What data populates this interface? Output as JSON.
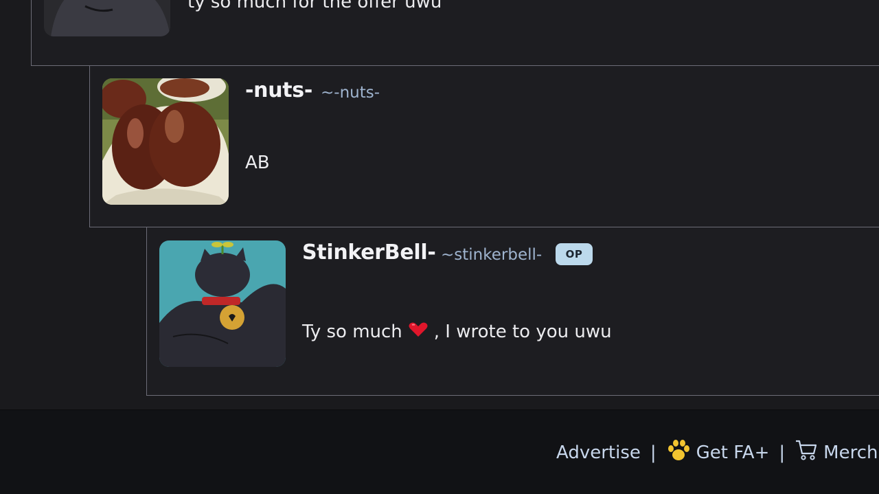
{
  "comments": [
    {
      "message": "ty so much for the offer uwu"
    },
    {
      "display_name": "-nuts-",
      "username": "~-nuts-",
      "message": "AB"
    },
    {
      "display_name": "StinkerBell-",
      "username": "~stinkerbell-",
      "badge": "OP",
      "message_before": "Ty so much",
      "message_after": ", I wrote to you uwu"
    }
  ],
  "footer": {
    "advertise": "Advertise",
    "separator": "|",
    "get_fa_plus": "Get FA+",
    "merch": "Merch S"
  },
  "icons": {
    "heart": "heart-emoji-icon",
    "paw": "paw-icon",
    "cart": "cart-icon"
  },
  "colors": {
    "background": "#1a1a1d",
    "comment_border": "#6d6d78",
    "handle": "#9fb4cf",
    "op_badge": "#bcd9ec",
    "footer_link": "#c8d7ec",
    "paw": "#f2c430",
    "heart": "#e0162b"
  }
}
